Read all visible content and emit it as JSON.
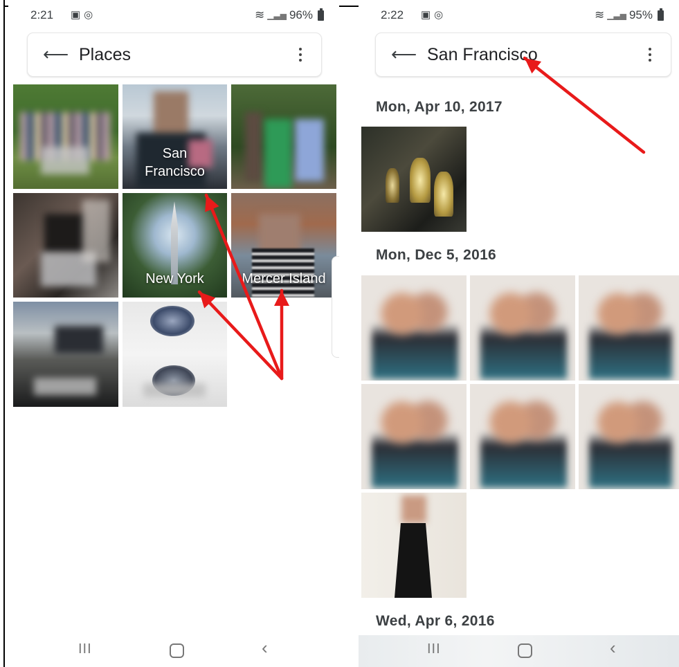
{
  "left": {
    "status_time": "2:21",
    "battery": "96%",
    "title": "Places",
    "places": [
      {
        "label": ""
      },
      {
        "label": "San\nFrancisco"
      },
      {
        "label": ""
      },
      {
        "label": ""
      },
      {
        "label": "New York"
      },
      {
        "label": "Mercer Island"
      },
      {
        "label": ""
      },
      {
        "label": ""
      }
    ]
  },
  "right": {
    "status_time": "2:22",
    "battery": "95%",
    "title": "San Francisco",
    "dates": [
      "Mon, Apr 10, 2017",
      "Mon, Dec 5, 2016",
      "Wed, Apr 6, 2016"
    ]
  },
  "nav": {
    "recent": "III"
  },
  "icons": {
    "back": "arrow-left",
    "more": "more-vert",
    "nav_home": "home-outline",
    "nav_back": "chevron-left"
  },
  "colors": {
    "annotation_arrow": "#e81a1a"
  }
}
